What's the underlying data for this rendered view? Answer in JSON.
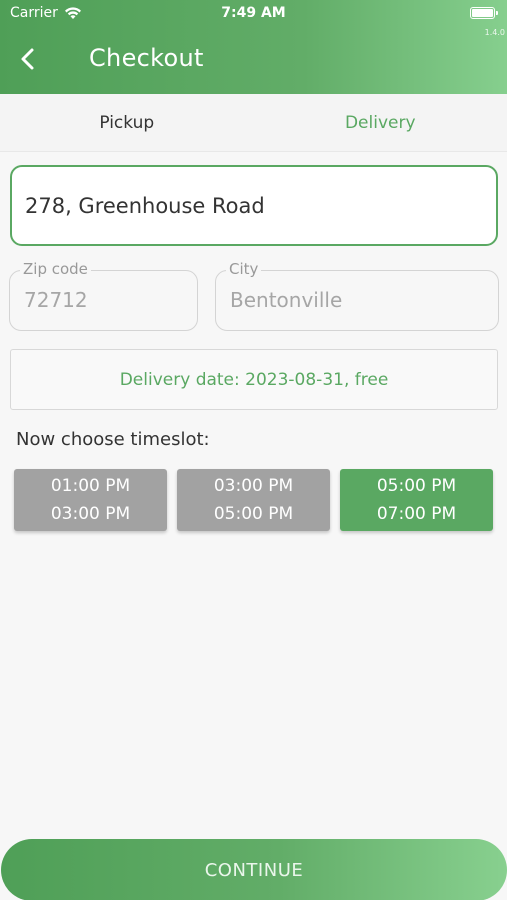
{
  "status_bar": {
    "carrier": "Carrier",
    "time": "7:49 AM",
    "version": "1.4.0"
  },
  "header": {
    "title": "Checkout",
    "back_icon": "chevron-left-icon"
  },
  "tabs": [
    {
      "label": "Pickup",
      "selected": false
    },
    {
      "label": "Delivery",
      "selected": true
    }
  ],
  "address": {
    "value": "278, Greenhouse Road"
  },
  "zip": {
    "label": "Zip code",
    "value": "72712"
  },
  "city": {
    "label": "City",
    "value": "Bentonville"
  },
  "delivery_date": "Delivery date: 2023-08-31, free",
  "timeslot_title": "Now choose timeslot:",
  "timeslots": [
    {
      "start": "01:00 PM",
      "end": "03:00 PM",
      "selected": false
    },
    {
      "start": "03:00 PM",
      "end": "05:00 PM",
      "selected": false
    },
    {
      "start": "05:00 PM",
      "end": "07:00 PM",
      "selected": true
    }
  ],
  "continue_label": "CONTINUE",
  "colors": {
    "accent": "#5aa862",
    "slot_inactive": "#a2a2a2"
  }
}
